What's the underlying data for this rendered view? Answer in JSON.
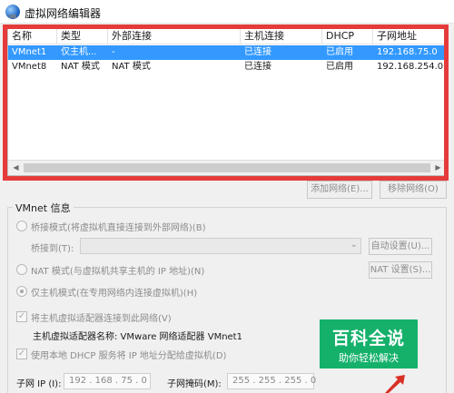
{
  "window": {
    "title": "虚拟网络编辑器",
    "icon": "network-globe-icon"
  },
  "table": {
    "columns": [
      "名称",
      "类型",
      "外部连接",
      "主机连接",
      "DHCP",
      "子网地址"
    ],
    "rows": [
      {
        "name": "VMnet1",
        "type": "仅主机...",
        "external": "-",
        "host": "已连接",
        "dhcp": "已启用",
        "subnet": "192.168.75.0",
        "selected": true
      },
      {
        "name": "VMnet8",
        "type": "NAT 模式",
        "external": "NAT 模式",
        "host": "已连接",
        "dhcp": "已启用",
        "subnet": "192.168.254.0",
        "selected": false
      }
    ]
  },
  "buttons": {
    "add_network": "添加网络(E)...",
    "remove_network": "移除网络(O)"
  },
  "vmnet_info": {
    "group_title": "VMnet 信息",
    "bridged_label": "桥接模式(将虚拟机直接连接到外部网络)(B)",
    "bridged_to_label": "桥接到(T):",
    "bridged_to_value": "",
    "auto_settings": "自动设置(U)...",
    "nat_label": "NAT 模式(与虚拟机共享主机的 IP 地址)(N)",
    "nat_settings": "NAT 设置(S)...",
    "host_only_label": "仅主机模式(在专用网络内连接虚拟机)(H)",
    "selected_mode": "host-only",
    "connect_adapter_label": "将主机虚拟适配器连接到此网络(V)",
    "connect_adapter_checked": true,
    "adapter_name_label": "主机虚拟适配器名称: VMware 网络适配器 VMnet1",
    "dhcp_label": "使用本地 DHCP 服务将 IP 地址分配给虚拟机(D)",
    "dhcp_checked": true,
    "subnet_ip_label": "子网 IP (I):",
    "subnet_ip_value": "192 . 168 . 75 . 0",
    "subnet_mask_label": "子网掩码(M):",
    "subnet_mask_value": "255 . 255 . 255 . 0"
  },
  "watermark": {
    "title": "百科全说",
    "subtitle": "助你轻松解决"
  },
  "colors": {
    "selection": "#3399ff",
    "highlight_frame": "#e63b3b",
    "watermark": "#15b16b"
  }
}
